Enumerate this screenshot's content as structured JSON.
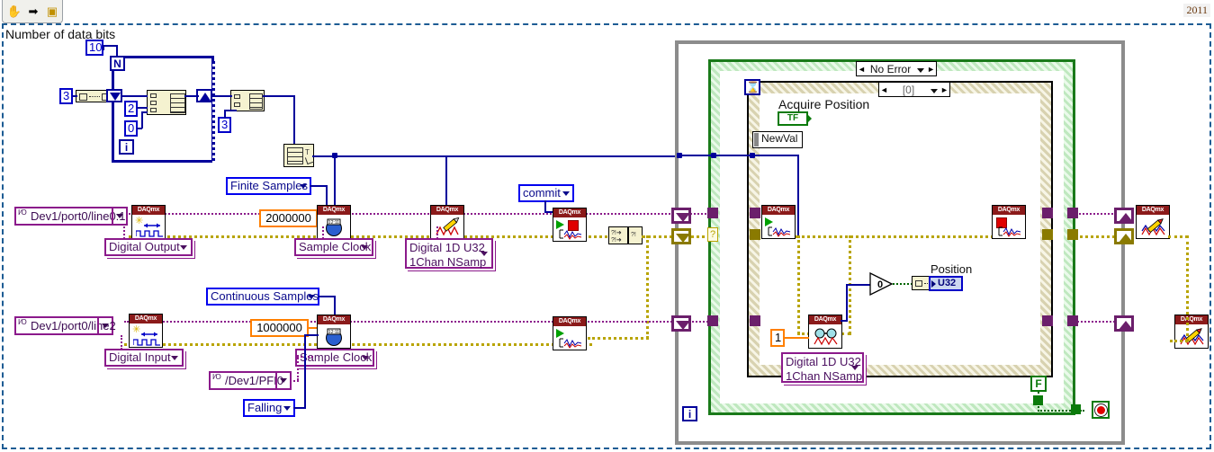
{
  "window": {
    "version_label": "2011",
    "toolbar": {
      "buttons": [
        {
          "name": "hand-tool",
          "glyph": "✋"
        },
        {
          "name": "arrow-tool",
          "glyph": "➡"
        },
        {
          "name": "vi-icon",
          "glyph": "▣"
        }
      ]
    }
  },
  "labels": {
    "number_of_data_bits": "Number of data bits",
    "acquire_position": "Acquire Position",
    "position": "Position"
  },
  "constants": {
    "iterations": "10",
    "bits": "3",
    "two": "2",
    "zero": "0",
    "three": "3",
    "do_samples": "2000000",
    "di_samples": "1000000",
    "read_count": "1",
    "loop_N": "N",
    "loop_i": "i",
    "false_const": "F",
    "zero_compare": "0"
  },
  "rings": {
    "finite_samples": "Finite Samples",
    "continuous_samples": "Continuous Samples",
    "commit": "commit",
    "falling": "Falling",
    "digital_output": "Digital Output",
    "digital_input": "Digital Input",
    "sample_clock_do": "Sample Clock",
    "sample_clock_di": "Sample Clock",
    "write_type": "Digital 1D U32\n1Chan NSamp",
    "read_type": "Digital 1D U32\n1Chan NSamp"
  },
  "channels": {
    "do_channel": "Dev1/port0/line0:1",
    "di_channel": "Dev1/port0/line2",
    "pfi_source": "/Dev1/PFI0"
  },
  "selectors": {
    "case_error": "No Error",
    "event_case": "[0]"
  },
  "event": {
    "new_val_terminal": "NewVal",
    "boolean_ref": "TF"
  },
  "indicators": {
    "position_type": "U32"
  },
  "colors": {
    "wire_blue": "#00009b",
    "error_wire": "#8b1a8b",
    "task_wire": "#b8a400",
    "bool_wire": "#006400",
    "sequence_gray": "#8c8c8c",
    "while_loop_green": "#1a7a1a",
    "daqmx_header": "#8b1a1a",
    "orange_const": "#ff7f00"
  },
  "node_labels": {
    "daqmx_create_channel": "DAQmx Create Channel",
    "daqmx_timing": "DAQmx Timing",
    "daqmx_write": "DAQmx Write",
    "daqmx_control_task": "DAQmx Control Task",
    "daqmx_start_task": "DAQmx Start Task",
    "daqmx_stop_task": "DAQmx Stop Task",
    "daqmx_read": "DAQmx Read",
    "daqmx_clear_task": "DAQmx Clear Task"
  }
}
